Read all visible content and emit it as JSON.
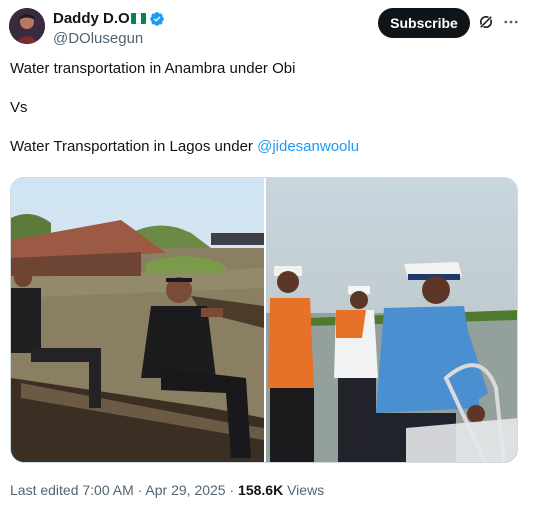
{
  "author": {
    "display_name": "Daddy D.O",
    "handle": "@DOlusegun",
    "verified": true,
    "flag_icon": "nigeria-flag-icon",
    "flag_colors": [
      "#008751",
      "#ffffff",
      "#008751"
    ],
    "verified_color": "#1d9bf0"
  },
  "actions": {
    "subscribe_label": "Subscribe",
    "grok_icon": "grok-icon",
    "more_icon": "more-options-icon"
  },
  "tweet": {
    "line1": "Water transportation in Anambra under Obi",
    "line2": "Vs",
    "line3_prefix": "Water Transportation in Lagos under ",
    "mention": "@jidesanwoolu",
    "mention_color": "#1d9bf0"
  },
  "media": {
    "image_count": 2
  },
  "meta": {
    "edited": "Last edited 7:00 AM · Apr 29, 2025 · ",
    "views_count": "158.6K",
    "views_label": " Views"
  }
}
